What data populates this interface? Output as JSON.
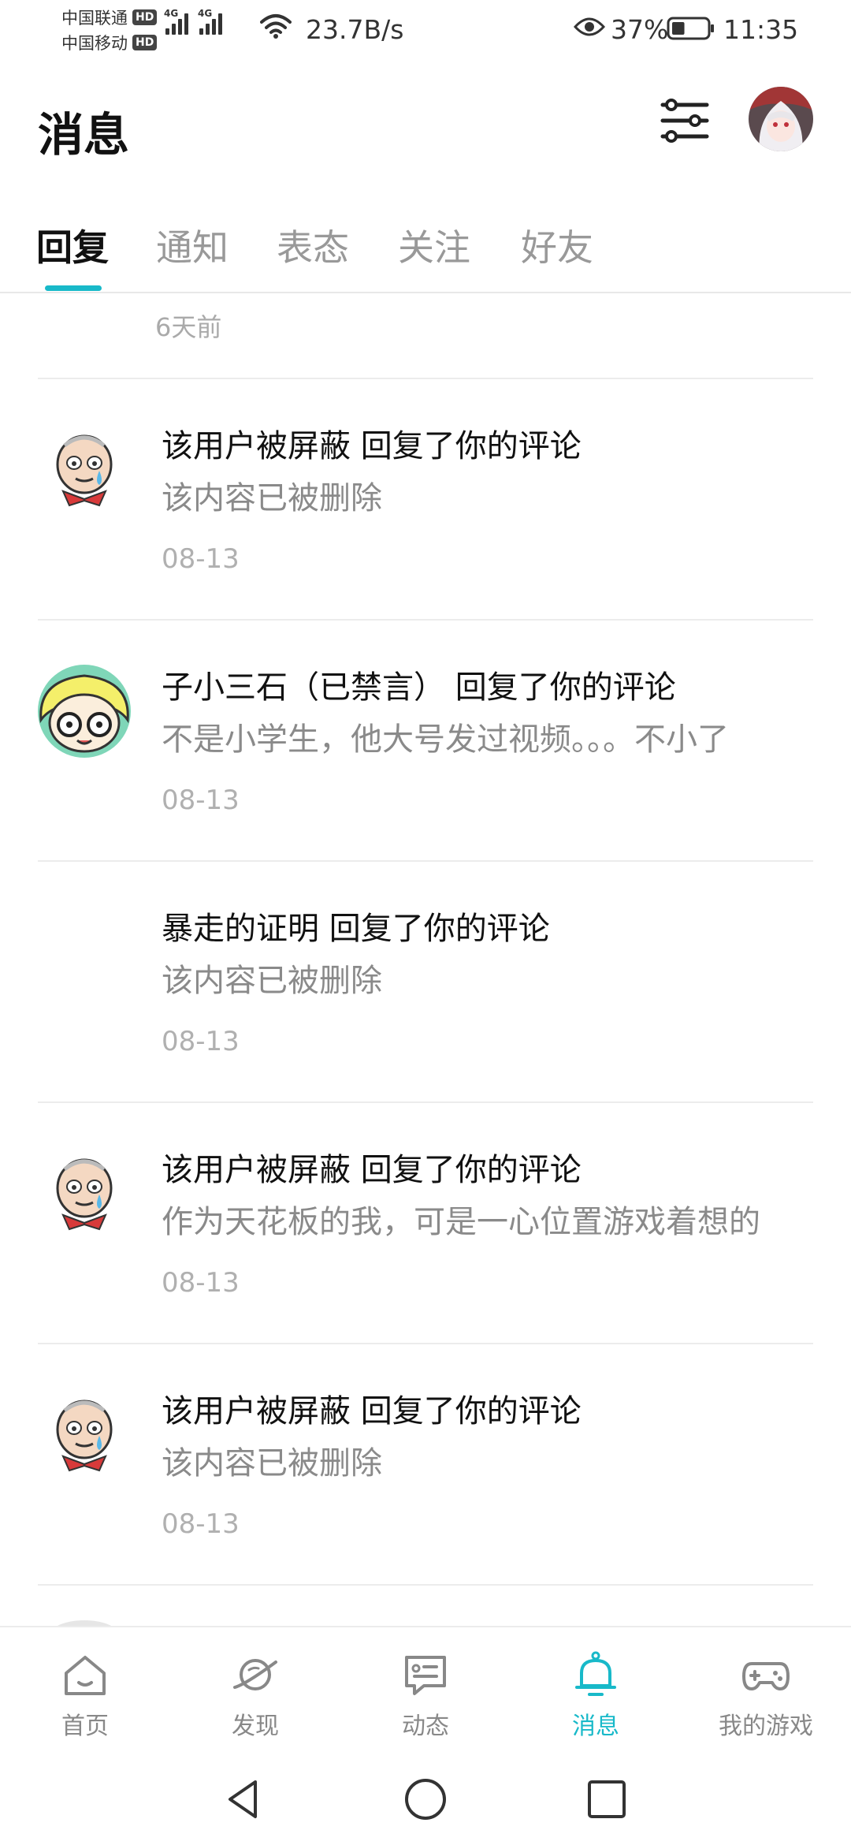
{
  "status_bar": {
    "carrier1": "中国联通",
    "carrier2": "中国移动",
    "hd_badge": "HD",
    "network_type": "4G",
    "net_speed": "23.7B/s",
    "battery": "37%",
    "battery_level": 0.37,
    "time": "11:35"
  },
  "header": {
    "title": "消息",
    "filter_icon": "sliders-icon",
    "avatar_icon": "user-avatar"
  },
  "tabs": {
    "items": [
      {
        "label": "回复",
        "active": true
      },
      {
        "label": "通知",
        "active": false
      },
      {
        "label": "表态",
        "active": false
      },
      {
        "label": "关注",
        "active": false
      },
      {
        "label": "好友",
        "active": false
      }
    ],
    "accent_color": "#18b9c9"
  },
  "previous_item_time": "6天前",
  "messages": [
    {
      "title": "该用户被屏蔽 回复了你的评论",
      "body": "该内容已被删除",
      "time": "08-13",
      "avatar": "bald-cartoon-avatar"
    },
    {
      "title": "子小三石（已禁言） 回复了你的评论",
      "body": "不是小学生，他大号发过视频。。。不小了",
      "time": "08-13",
      "avatar": "yellow-hair-cartoon-avatar"
    },
    {
      "title": "暴走的证明 回复了你的评论",
      "body": "该内容已被删除",
      "time": "08-13",
      "avatar": "none"
    },
    {
      "title": "该用户被屏蔽 回复了你的评论",
      "body": "作为天花板的我，可是一心位置游戏着想的",
      "time": "08-13",
      "avatar": "bald-cartoon-avatar"
    },
    {
      "title": "该用户被屏蔽 回复了你的评论",
      "body": "该内容已被删除",
      "time": "08-13",
      "avatar": "bald-cartoon-avatar"
    }
  ],
  "bottom_nav": {
    "items": [
      {
        "label": "首页",
        "icon": "home-icon",
        "active": false
      },
      {
        "label": "发现",
        "icon": "planet-icon",
        "active": false
      },
      {
        "label": "动态",
        "icon": "chat-card-icon",
        "active": false
      },
      {
        "label": "消息",
        "icon": "bell-icon",
        "active": true
      },
      {
        "label": "我的游戏",
        "icon": "gamepad-icon",
        "active": false
      }
    ],
    "active_color": "#18b9c9",
    "inactive_color": "#888888"
  },
  "system_nav": {
    "back": "back-triangle-icon",
    "home": "home-circle-icon",
    "recents": "recents-square-icon"
  }
}
